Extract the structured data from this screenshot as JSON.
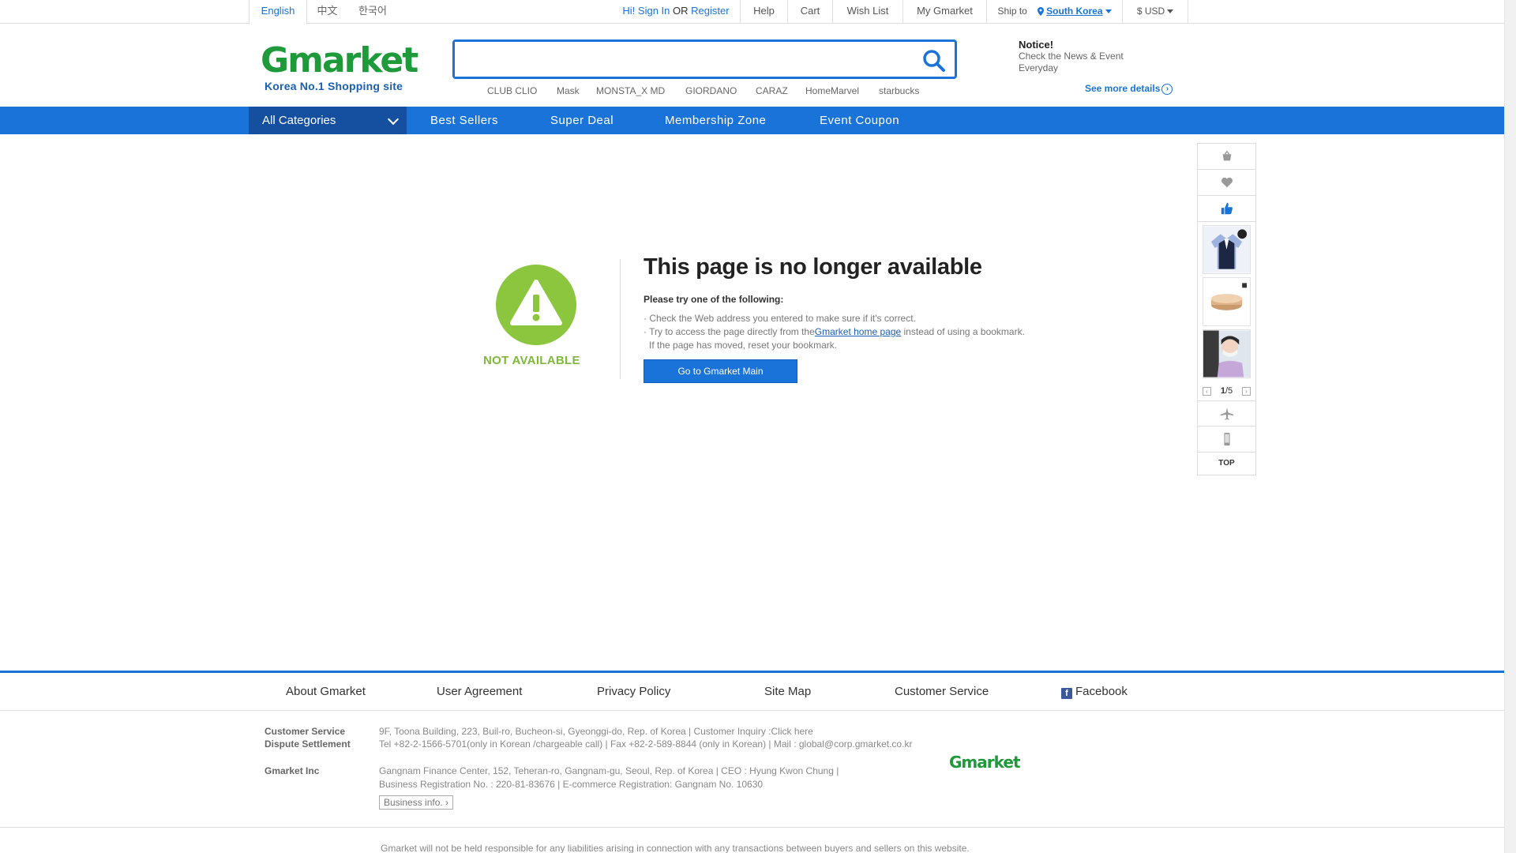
{
  "languages": [
    {
      "label": "English",
      "active": true
    },
    {
      "label": "中文",
      "active": false
    },
    {
      "label": "한국어",
      "active": false
    }
  ],
  "account": {
    "greeting": "Hi!",
    "sign_in": "Sign In",
    "or": "OR",
    "register": "Register"
  },
  "utility_links": {
    "help": "Help",
    "cart": "Cart",
    "wish_list": "Wish List",
    "my_gmarket": "My Gmarket"
  },
  "ship_to": {
    "label": "Ship to",
    "country": "South Korea"
  },
  "currency": "$ USD",
  "logo": {
    "word": "Gmarket",
    "tagline": "Korea No.1 Shopping site"
  },
  "search": {
    "value": "",
    "placeholder": ""
  },
  "keywords": [
    "CLUB CLIO",
    "Mask",
    "MONSTA_X MD",
    "GIORDANO",
    "CARAZ",
    "HomeMarvel",
    "starbucks"
  ],
  "notice": {
    "title": "Notice!",
    "line1": "Check the News & Event",
    "line2": "Everyday",
    "see_more": "See more details"
  },
  "nav": {
    "all_categories": "All Categories",
    "items": [
      "Best Sellers",
      "Super Deal",
      "Membership Zone",
      "Event Coupon"
    ]
  },
  "error": {
    "badge": "NOT AVAILABLE",
    "title": "This page is no longer available",
    "subtitle": "Please try one of the following:",
    "line1": "Check the Web address you entered to make sure if it's correct.",
    "line2_pre": "Try to access the page directly from the",
    "line2_link": "Gmarket home page",
    "line2_post": " instead of using a bookmark.",
    "line3": "If the page has moved, reset your bookmark.",
    "button": "Go to Gmarket Main"
  },
  "sidebar": {
    "pager_current": "1",
    "pager_total": "/5",
    "top": "TOP"
  },
  "footer": {
    "links": [
      "About Gmarket",
      "User Agreement",
      "Privacy Policy",
      "Site Map",
      "Customer Service",
      "Facebook"
    ],
    "cs_label": "Customer Service",
    "dispute_label": "Dispute Settlement",
    "cs_line1": "9F, Toona Building, 223, Buil-ro, Bucheon-si, Gyeonggi-do, Rep. of Korea | Customer Inquiry :Click here",
    "cs_line2": "Tel +82-2-1566-5701(only in Korean /chargeable call) | Fax +82-2-589-8844 (only in Korean) | Mail : global@corp.gmarket.co.kr",
    "inc_label": "Gmarket Inc",
    "inc_line1": "Gangnam Finance Center, 152, Teheran-ro, Gangnam-gu, Seoul, Rep. of Korea | CEO : Hyung Kwon Chung |",
    "inc_line2": "Business Registration No. : 220-81-83676 | E-commerce Registration: Gangnam No. 10630",
    "business_info": "Business info.",
    "logo": "Gmarket",
    "disclaimer": "Gmarket will not be held responsible for any liabilities arising in connection with any transactions between buyers and sellers on this website."
  },
  "colors": {
    "brand_blue": "#1a73d9",
    "nav_dark": "#154fa0",
    "logo_green": "#1e9a3a",
    "not_available_green": "#8cc63f"
  }
}
